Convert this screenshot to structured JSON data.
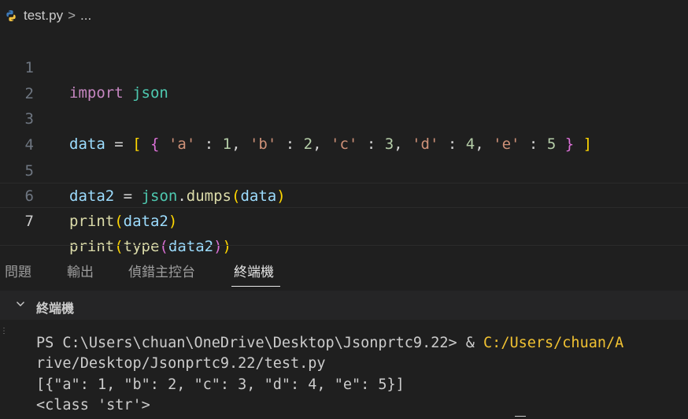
{
  "breadcrumb": {
    "file": "test.py",
    "separator": ">",
    "ellipsis": "..."
  },
  "editor": {
    "line_numbers": [
      "1",
      "2",
      "3",
      "4",
      "5",
      "6",
      "7"
    ],
    "active_line": "7",
    "line1": {
      "kw": "import",
      "module": "json"
    },
    "line3": {
      "var": "data",
      "eq": "=",
      "lbracket": "[",
      "lbrace": "{",
      "k1": "'a'",
      "v1": "1",
      "k2": "'b'",
      "v2": "2",
      "k3": "'c'",
      "v3": "3",
      "k4": "'d'",
      "v4": "4",
      "k5": "'e'",
      "v5": "5",
      "rbrace": "}",
      "rbracket": "]",
      "colon": ":",
      "comma": ","
    },
    "line5": {
      "var": "data2",
      "eq": "=",
      "module": "json",
      "dot": ".",
      "fn": "dumps",
      "lp": "(",
      "arg": "data",
      "rp": ")"
    },
    "line6": {
      "fn": "print",
      "lp": "(",
      "arg": "data2",
      "rp": ")"
    },
    "line7": {
      "fn": "print",
      "lp1": "(",
      "fn2": "type",
      "lp2": "(",
      "arg": "data2",
      "rp2": ")",
      "rp1": ")"
    }
  },
  "panel": {
    "tabs": [
      "問題",
      "輸出",
      "偵錯主控台",
      "終端機"
    ],
    "active_tab": "終端機",
    "terminal_header": "終端機"
  },
  "terminal": {
    "prompt": "PS C:\\Users\\chuan\\OneDrive\\Desktop\\Jsonprtc9.22> & ",
    "exe_path": "C:/Users/chuan/A",
    "line2": "rive/Desktop/Jsonprtc9.22/test.py",
    "line3": "[{\"a\": 1, \"b\": 2, \"c\": 3, \"d\": 4, \"e\": 5}]",
    "line4": "<class 'str'>"
  },
  "colors": {
    "keyword": "#c586c0",
    "variable": "#9cdcfe",
    "string": "#ce9178",
    "number": "#b5cea8",
    "function": "#dcdcaa",
    "module": "#4ec9b0",
    "path": "#f1c232"
  }
}
